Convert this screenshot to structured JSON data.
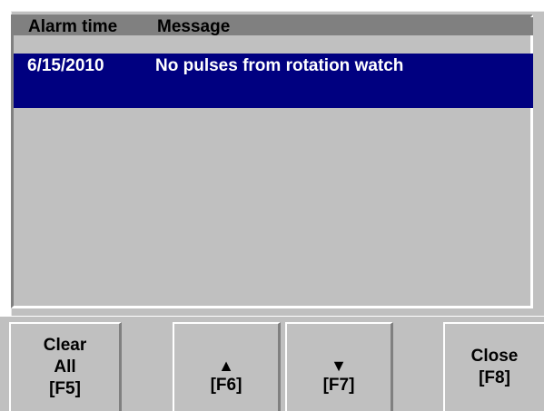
{
  "list": {
    "columns": [
      "Alarm time",
      "Message"
    ],
    "rows": [
      {
        "time": "6/15/2010",
        "message": "No pulses from rotation watch"
      }
    ]
  },
  "buttons": {
    "clear_all": {
      "line1": "Clear",
      "line2": "All",
      "key": "[F5]"
    },
    "up": {
      "icon": "up-triangle-icon",
      "glyph": "▲",
      "key": "[F6]"
    },
    "down": {
      "icon": "down-triangle-icon",
      "glyph": "▼",
      "key": "[F7]"
    },
    "close": {
      "label": "Close",
      "key": "[F8]"
    }
  },
  "colors": {
    "selection": "#000080",
    "header": "#808080",
    "face": "#c0c0c0"
  }
}
